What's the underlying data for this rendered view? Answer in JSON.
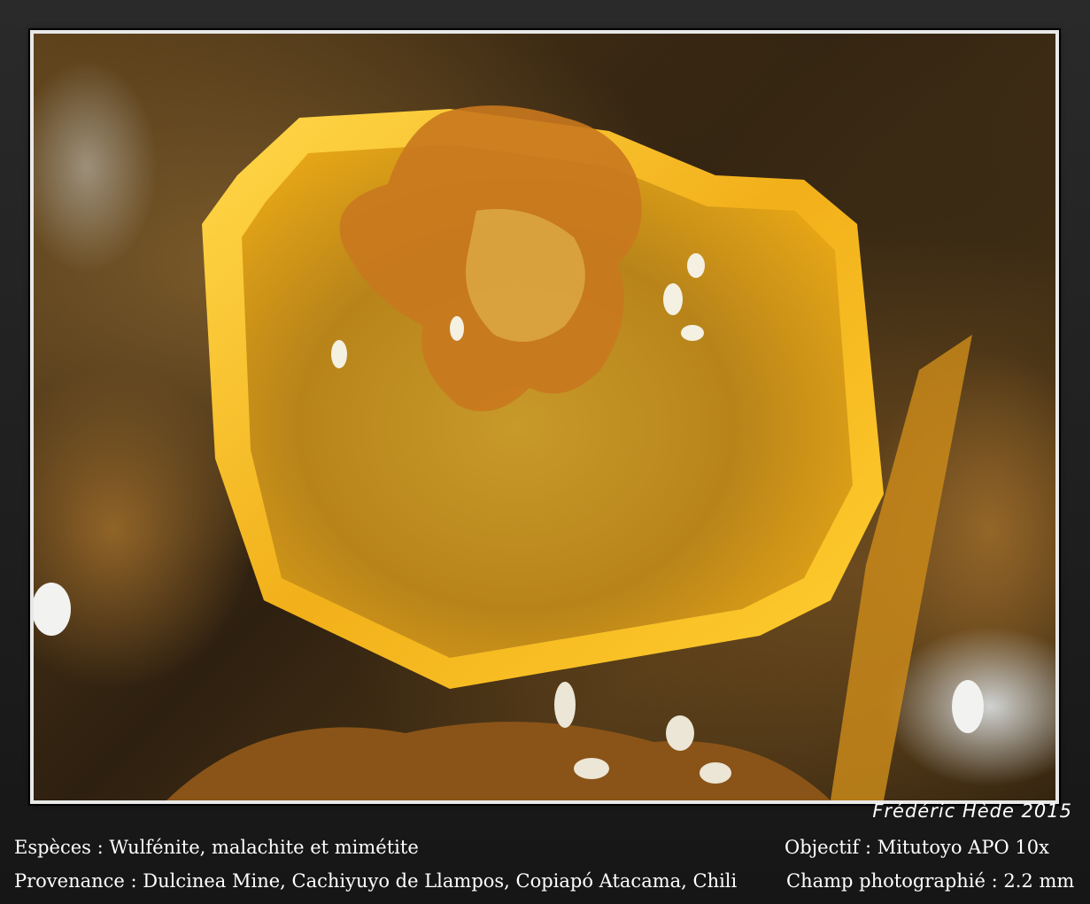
{
  "photo": {
    "subject": "wulfenite-crystal-photo",
    "colors": {
      "crystal": "#f0b020",
      "crystal_edge": "#ffd24a",
      "matrix": "#b46a1e",
      "background": "#3a2a14"
    }
  },
  "credit": "Frédéric Hède 2015",
  "caption": {
    "species": "Espèces : Wulfénite, malachite et mimétite",
    "provenance": "Provenance : Dulcinea Mine, Cachiyuyo de Llampos, Copiapó Atacama, Chili",
    "objective": "Objectif : Mitutoyo APO 10x",
    "field": "Champ photographié : 2.2 mm"
  }
}
